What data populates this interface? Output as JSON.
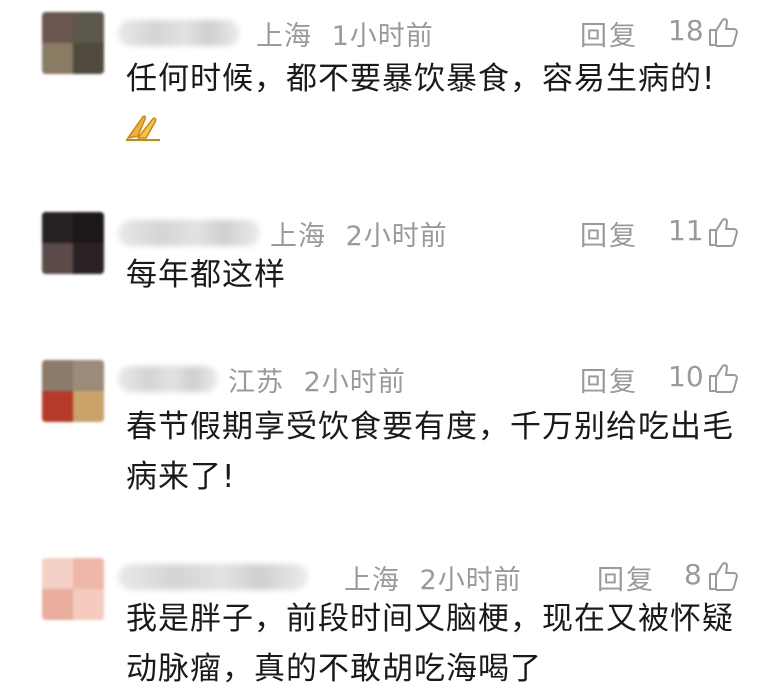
{
  "comments": [
    {
      "location": "上海",
      "time": "1小时前",
      "reply_label": "回复",
      "likes": "18",
      "text": "任何时候，都不要暴饮暴食，容易生病的!",
      "emoji": "praying-hands-icon"
    },
    {
      "location": "上海",
      "time": "2小时前",
      "reply_label": "回复",
      "likes": "11",
      "text": "每年都这样"
    },
    {
      "location": "江苏",
      "time": "2小时前",
      "reply_label": "回复",
      "likes": "10",
      "text": "春节假期享受饮食要有度，千万别给吃出毛病来了!"
    },
    {
      "location": "上海",
      "time": "2小时前",
      "reply_label": "回复",
      "likes": "8",
      "text": "我是胖子，前段时间又脑梗，现在又被怀疑动脉瘤，真的不敢胡吃海喝了"
    }
  ],
  "colors": {
    "meta_text": "#9a9a9a",
    "body_text": "#1a1a1a",
    "background": "#ffffff"
  }
}
